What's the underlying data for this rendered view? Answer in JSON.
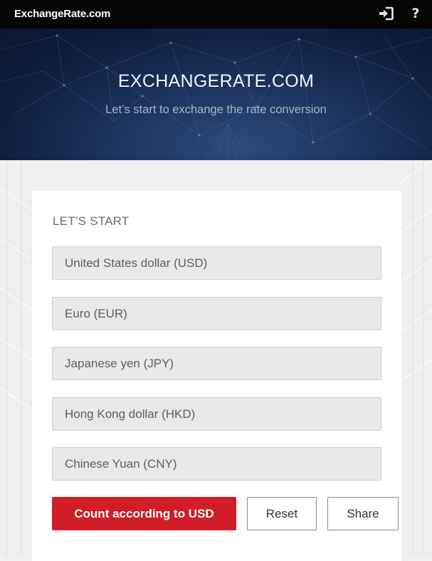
{
  "header": {
    "brand": "ExchangeRate.com",
    "icons": [
      "sign-in-icon",
      "help-icon"
    ],
    "help_glyph": "?"
  },
  "hero": {
    "title": "EXCHANGERATE.COM",
    "subtitle": "Let’s start to exchange the rate conversion"
  },
  "form": {
    "heading": "LET’S START",
    "fields": [
      {
        "placeholder": "United States dollar (USD)",
        "value": ""
      },
      {
        "placeholder": "Euro (EUR)",
        "value": ""
      },
      {
        "placeholder": "Japanese yen (JPY)",
        "value": ""
      },
      {
        "placeholder": "Hong Kong dollar (HKD)",
        "value": ""
      },
      {
        "placeholder": "Chinese Yuan (CNY)",
        "value": ""
      }
    ],
    "buttons": {
      "count": "Count according to USD",
      "reset": "Reset",
      "share": "Share"
    }
  },
  "colors": {
    "topbar": "#050505",
    "hero_dark": "#0a1530",
    "hero_mid": "#2c4a7c",
    "accent_red": "#d01d27",
    "field_bg": "#e9e9e9",
    "page_bg": "#efefef"
  }
}
